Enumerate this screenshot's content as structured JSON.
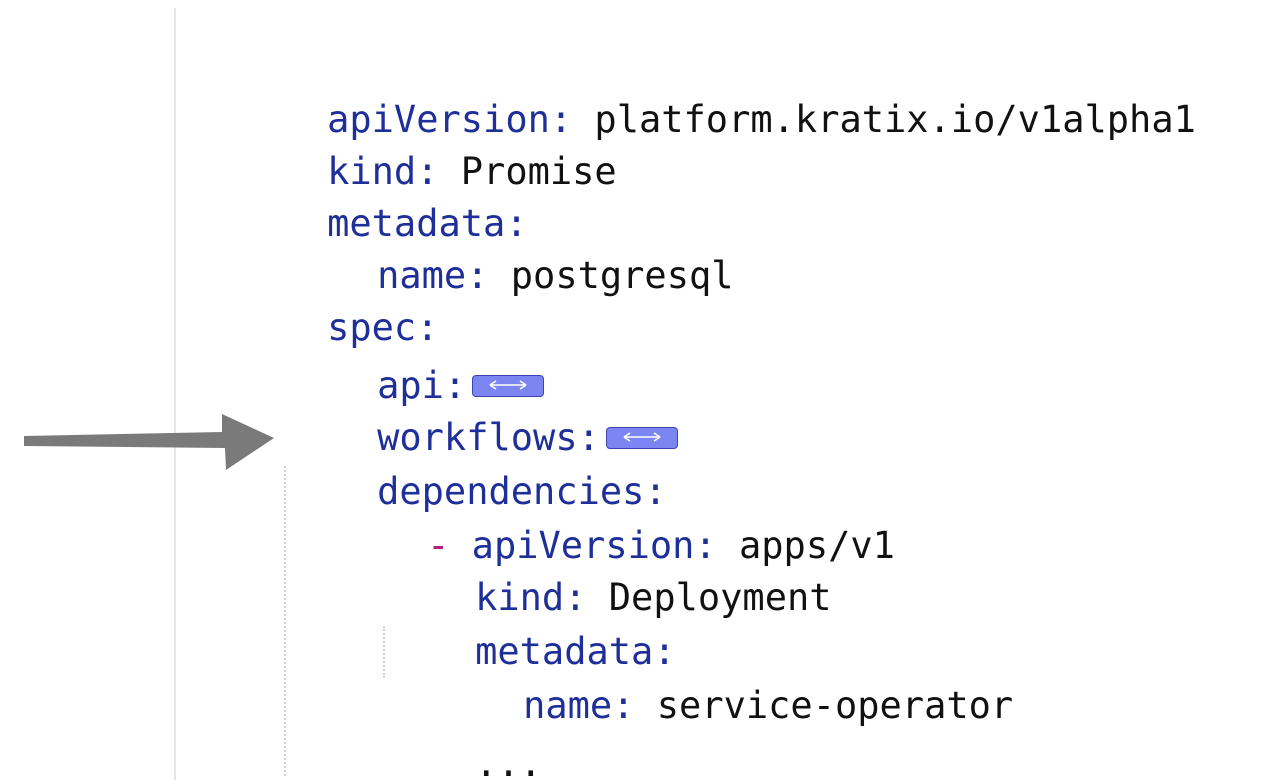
{
  "colors": {
    "key": "#1f2f9a",
    "value": "#111111",
    "dash": "#b01f7a",
    "fold_fill": "#7c86f2",
    "arrow": "#7a7a7a"
  },
  "code": {
    "lines": [
      {
        "key": "apiVersion:",
        "value": " platform.kratix.io/v1alpha1"
      },
      {
        "key": "kind:",
        "value": " Promise"
      },
      {
        "key": "metadata:",
        "value": ""
      },
      {
        "key": "name:",
        "value": " postgresql"
      },
      {
        "key": "spec:",
        "value": ""
      },
      {
        "key": "api:",
        "value": "",
        "fold_icon": "fold-expand-icon"
      },
      {
        "key": "workflows:",
        "value": "",
        "fold_icon": "fold-expand-icon"
      },
      {
        "key": "dependencies:",
        "value": ""
      },
      {
        "dash": "- ",
        "key": "apiVersion:",
        "value": " apps/v1"
      },
      {
        "key": "kind:",
        "value": " Deployment"
      },
      {
        "key": "metadata:",
        "value": ""
      },
      {
        "key": "name:",
        "value": " service-operator"
      },
      {
        "value": "..."
      }
    ]
  },
  "annotation": {
    "icon": "pointer-arrow-icon"
  }
}
